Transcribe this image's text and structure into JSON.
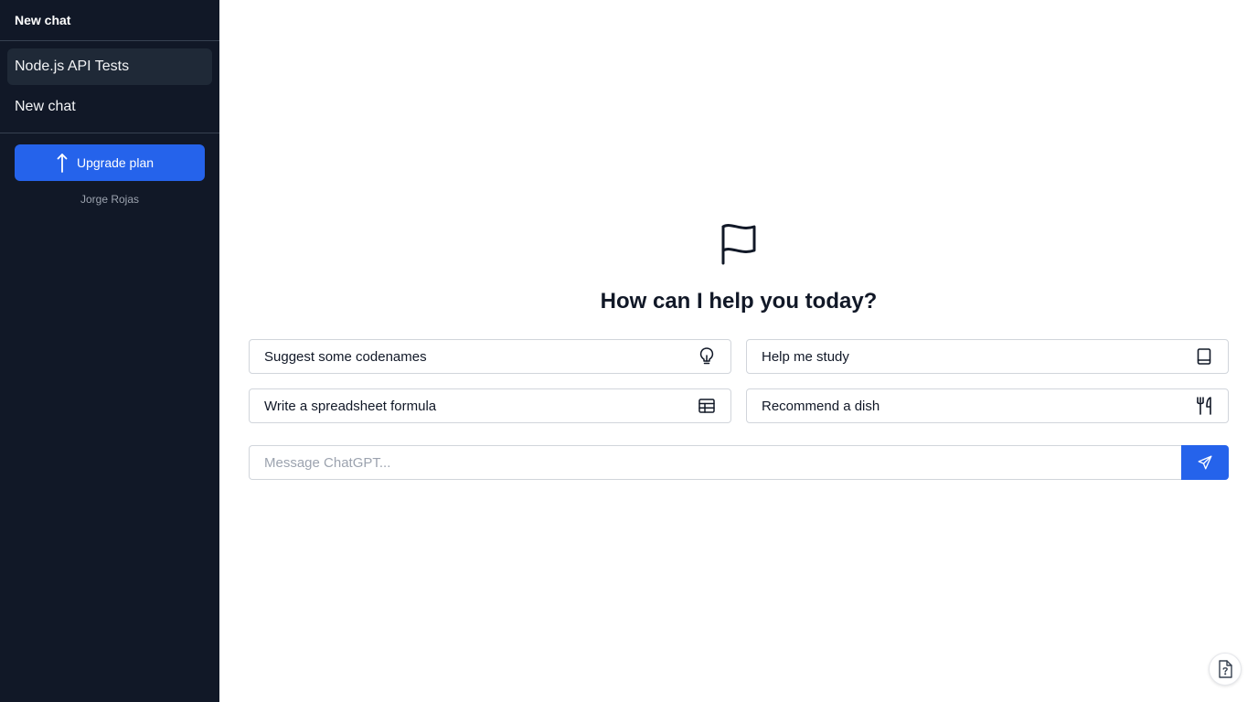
{
  "sidebar": {
    "title": "New chat",
    "chats": [
      {
        "label": "Node.js API Tests",
        "active": true
      },
      {
        "label": "New chat",
        "active": false
      }
    ],
    "upgrade_label": "Upgrade plan",
    "user_name": "Jorge Rojas"
  },
  "main": {
    "hero_icon": "flag-icon",
    "heading": "How can I help you today?",
    "suggestions": [
      {
        "label": "Suggest some codenames",
        "icon": "lightbulb-icon"
      },
      {
        "label": "Help me study",
        "icon": "book-icon"
      },
      {
        "label": "Write a spreadsheet formula",
        "icon": "table-icon"
      },
      {
        "label": "Recommend a dish",
        "icon": "utensils-icon"
      }
    ],
    "composer": {
      "placeholder": "Message ChatGPT...",
      "value": "",
      "send_icon": "send-plane-icon"
    },
    "help_icon": "help-document-icon"
  },
  "colors": {
    "sidebar_bg": "#111827",
    "accent": "#2563eb",
    "active_item_bg": "#1f2937"
  }
}
